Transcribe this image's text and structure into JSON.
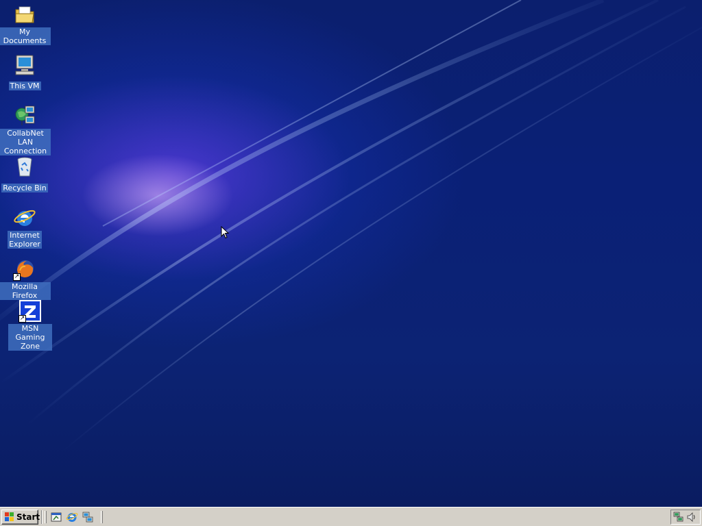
{
  "desktop": {
    "icons": [
      {
        "label": "My Documents",
        "icon": "folder-icon"
      },
      {
        "label": "This VM",
        "icon": "computer-icon"
      },
      {
        "label": "CollabNet LAN Connection",
        "icon": "network-icon"
      },
      {
        "label": "Recycle Bin",
        "icon": "recycle-bin-icon"
      },
      {
        "label": "Internet Explorer",
        "icon": "internet-explorer-icon"
      },
      {
        "label": "Mozilla Firefox",
        "icon": "firefox-icon"
      },
      {
        "label": "MSN Gaming Zone",
        "icon": "msn-zone-icon"
      }
    ],
    "background_color": "#0a2076"
  },
  "taskbar": {
    "start_label": "Start",
    "quick_launch": [
      {
        "icon": "show-desktop-icon"
      },
      {
        "icon": "internet-explorer-icon"
      },
      {
        "icon": "network-icon"
      }
    ],
    "tray": [
      {
        "icon": "network-tray-icon"
      },
      {
        "icon": "volume-icon"
      }
    ],
    "background_color": "#d4d0c8"
  }
}
